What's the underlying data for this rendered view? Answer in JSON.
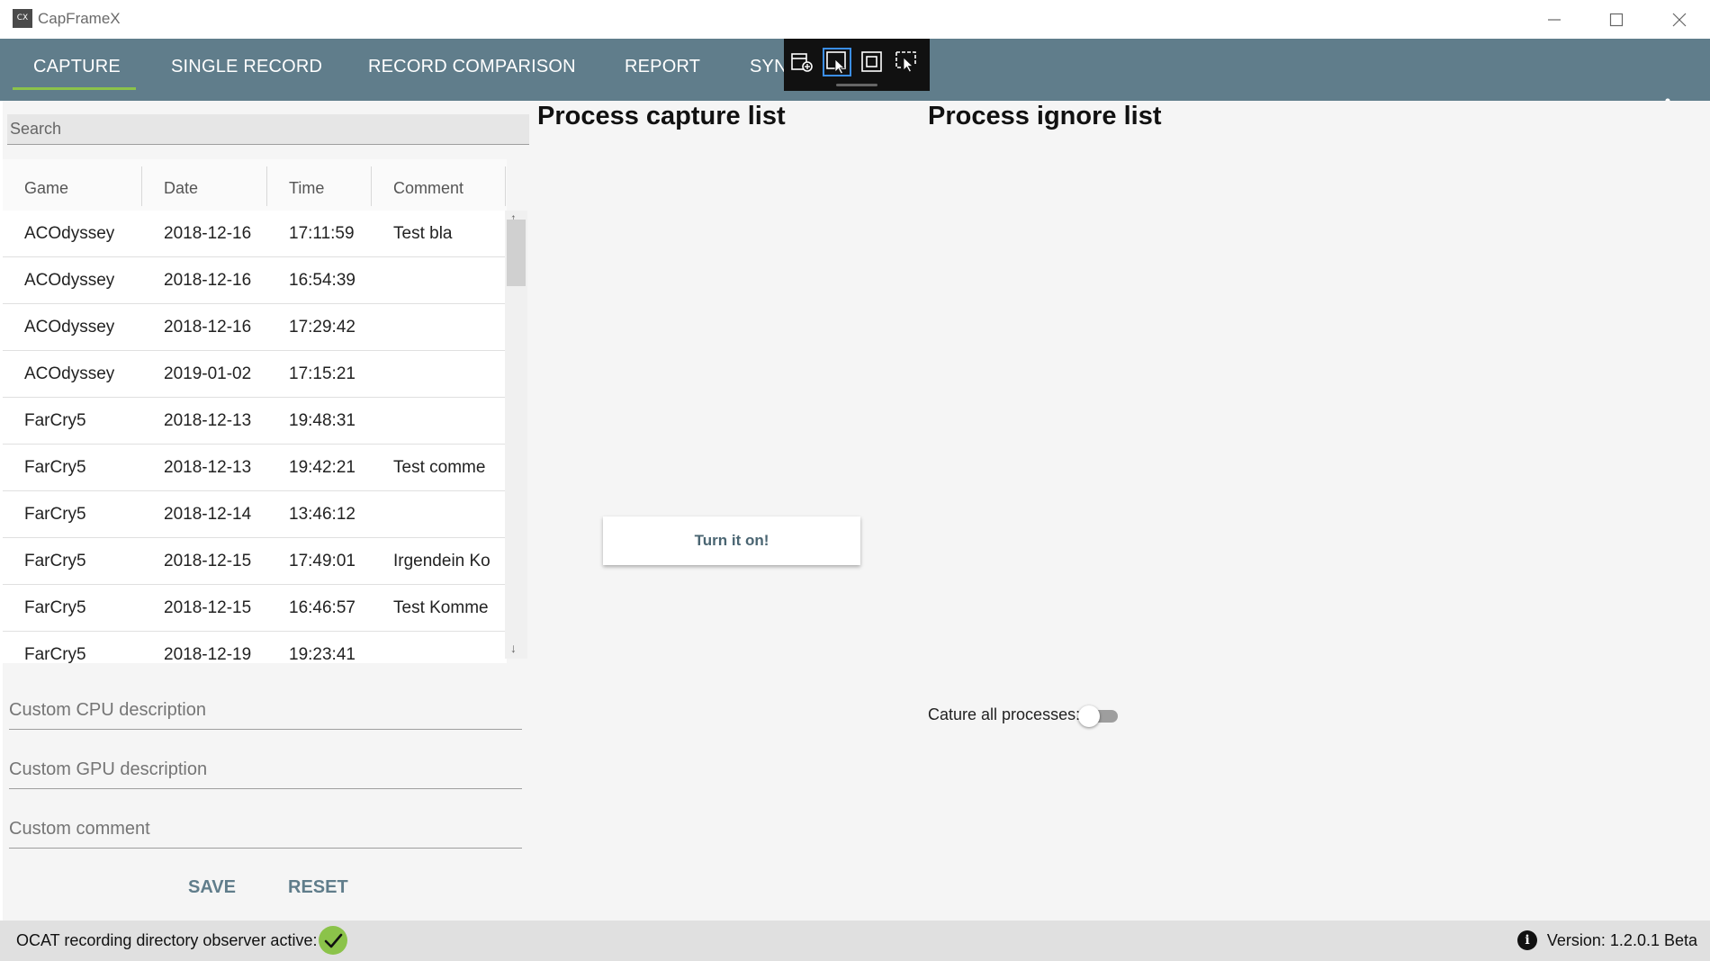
{
  "window": {
    "icon_text": "CX",
    "title": "CapFrameX"
  },
  "nav": {
    "tabs": [
      {
        "label": "CAPTURE",
        "active": true
      },
      {
        "label": "SINGLE RECORD"
      },
      {
        "label": "RECORD COMPARISON"
      },
      {
        "label": "REPORT"
      },
      {
        "label": "SYN"
      }
    ],
    "accent_color": "#8bc34a",
    "bar_color": "#607d8b"
  },
  "search": {
    "placeholder": "Search"
  },
  "table": {
    "columns": [
      "Game",
      "Date",
      "Time",
      "Comment"
    ],
    "rows": [
      {
        "game": "ACOdyssey",
        "date": "2018-12-16",
        "time": "17:11:59",
        "comment": "Test bla"
      },
      {
        "game": "ACOdyssey",
        "date": "2018-12-16",
        "time": "16:54:39",
        "comment": ""
      },
      {
        "game": "ACOdyssey",
        "date": "2018-12-16",
        "time": "17:29:42",
        "comment": ""
      },
      {
        "game": "ACOdyssey",
        "date": "2019-01-02",
        "time": "17:15:21",
        "comment": ""
      },
      {
        "game": "FarCry5",
        "date": "2018-12-13",
        "time": "19:48:31",
        "comment": ""
      },
      {
        "game": "FarCry5",
        "date": "2018-12-13",
        "time": "19:42:21",
        "comment": "Test comme"
      },
      {
        "game": "FarCry5",
        "date": "2018-12-14",
        "time": "13:46:12",
        "comment": ""
      },
      {
        "game": "FarCry5",
        "date": "2018-12-15",
        "time": "17:49:01",
        "comment": "Irgendein Ko"
      },
      {
        "game": "FarCry5",
        "date": "2018-12-15",
        "time": "16:46:57",
        "comment": "Test Komme"
      },
      {
        "game": "FarCry5",
        "date": "2018-12-19",
        "time": "19:23:41",
        "comment": ""
      }
    ]
  },
  "form": {
    "cpu_label": "Custom CPU description",
    "gpu_label": "Custom GPU description",
    "comment_label": "Custom comment",
    "save_label": "SAVE",
    "reset_label": "RESET"
  },
  "main": {
    "capture_heading": "Process capture list",
    "ignore_heading": "Process ignore list",
    "turn_on_label": "Turn it on!",
    "capture_all_label": "Cature all processes:",
    "capture_all_on": false
  },
  "status": {
    "observer_text": "OCAT recording directory observer active:",
    "version_text": "Version:  1.2.0.1 Beta"
  }
}
